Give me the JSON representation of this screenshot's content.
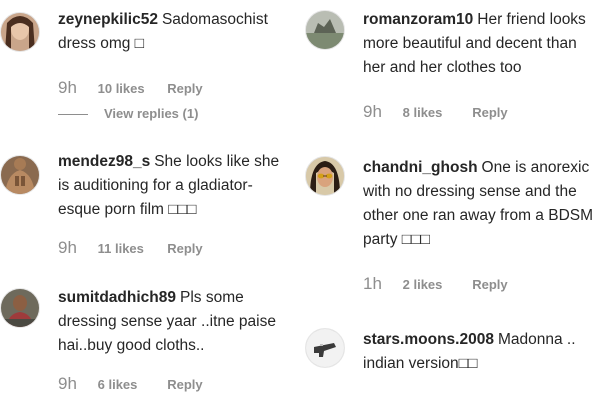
{
  "comments_left": [
    {
      "username": "zeynepkilic52",
      "text": "Sadomasochist dress omg □",
      "time": "9h",
      "likes": "10 likes",
      "reply": "Reply",
      "view_replies": "View replies (1)"
    },
    {
      "username": "mendez98_s",
      "text": "She looks like she is auditioning for a gladiator-esque porn film □□□",
      "time": "9h",
      "likes": "11 likes",
      "reply": "Reply"
    },
    {
      "username": "sumitdadhich89",
      "text": "Pls some dressing sense yaar ..itne paise hai..buy good cloths..",
      "time": "9h",
      "likes": "6 likes",
      "reply": "Reply"
    }
  ],
  "comments_right": [
    {
      "username": "romanzoram10",
      "text": "Her friend looks more beautiful and decent than her and her clothes too",
      "time": "9h",
      "likes": "8 likes",
      "reply": "Reply"
    },
    {
      "username": "chandni_ghosh",
      "text": "One is anorexic with no dressing sense and the other one ran away from a BDSM party □□□",
      "time": "1h",
      "likes": "2 likes",
      "reply": "Reply"
    },
    {
      "username": "stars.moons.2008",
      "text": "Madonna .. indian version□□"
    }
  ]
}
